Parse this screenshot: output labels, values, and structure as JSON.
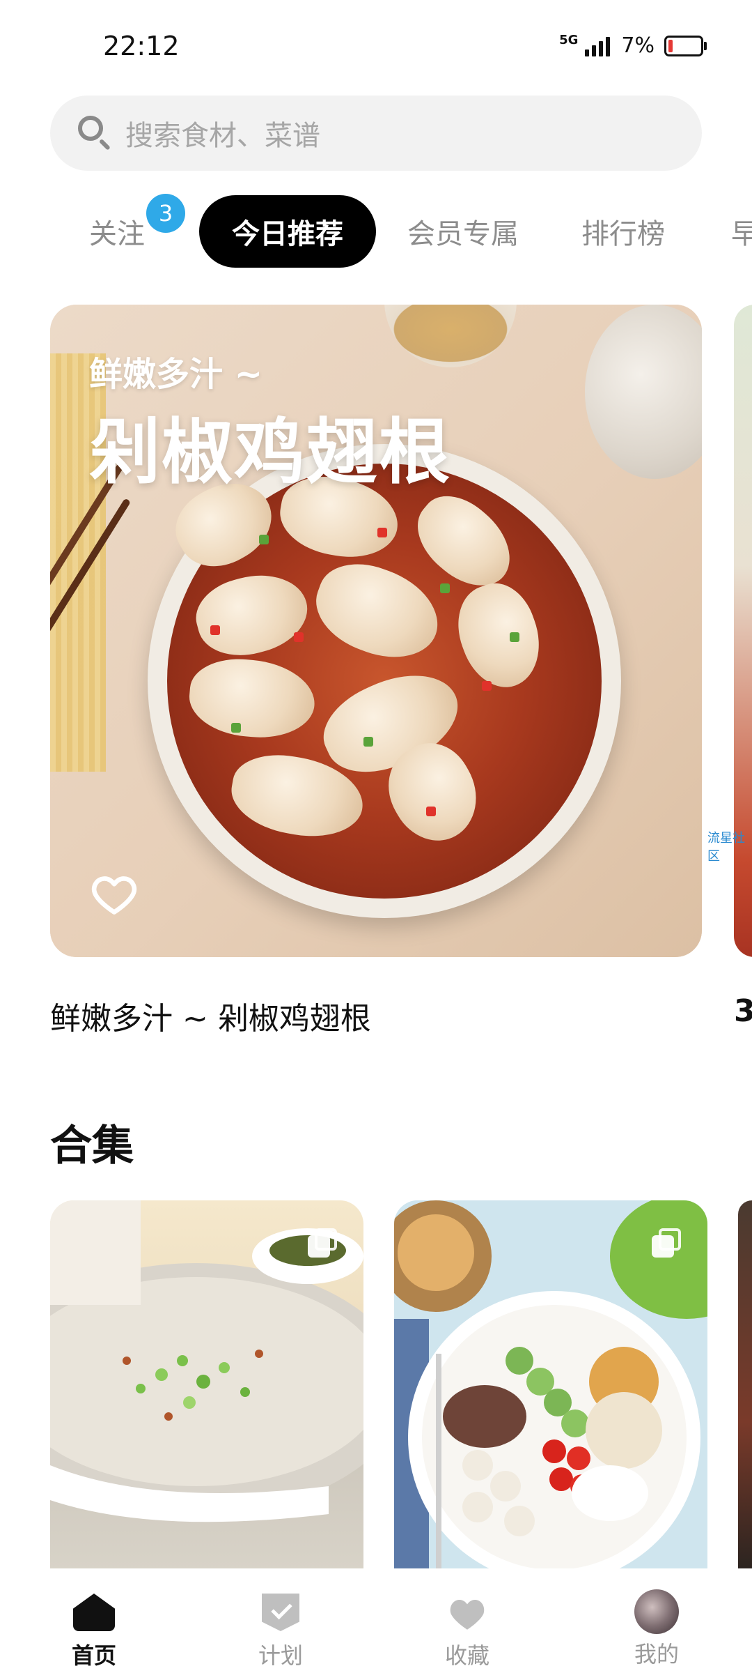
{
  "status_bar": {
    "time": "22:12",
    "network": "5G",
    "battery_percent": "7%",
    "battery_color": "#e53935"
  },
  "search": {
    "placeholder": "搜索食材、菜谱",
    "icon": "search-icon"
  },
  "tabs": [
    {
      "label": "关注",
      "badge": "3",
      "active": false
    },
    {
      "label": "今日推荐",
      "active": true
    },
    {
      "label": "会员专属",
      "active": false
    },
    {
      "label": "排行榜",
      "active": false
    },
    {
      "label": "早",
      "active": false
    }
  ],
  "hero": {
    "subtitle": "鲜嫩多汁 ~",
    "title": "剁椒鸡翅根",
    "caption": "鲜嫩多汁 ~ 剁椒鸡翅根",
    "favorite_icon": "heart-outline-icon",
    "next_caption_peek": "3",
    "next_card_overlay_text": "流星社区"
  },
  "collections": {
    "section_title": "合集",
    "card_icon": "stack-icon"
  },
  "bottom_nav": [
    {
      "label": "首页",
      "icon": "home-icon",
      "active": true
    },
    {
      "label": "计划",
      "icon": "plan-icon",
      "active": false
    },
    {
      "label": "收藏",
      "icon": "heart-icon",
      "active": false
    },
    {
      "label": "我的",
      "icon": "avatar",
      "active": false
    }
  ],
  "colors": {
    "accent_active_tab": "#000000",
    "badge": "#2fa9e8",
    "muted_text": "#8c8c8c"
  }
}
